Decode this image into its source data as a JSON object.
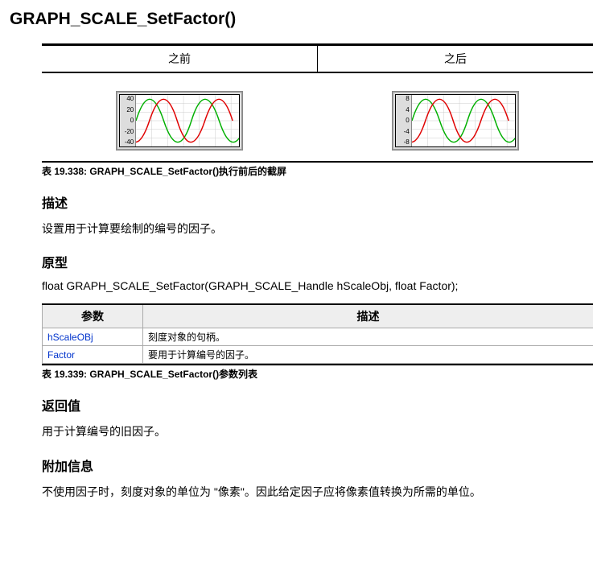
{
  "title": "GRAPH_SCALE_SetFactor()",
  "before_after": {
    "before_label": "之前",
    "after_label": "之后",
    "caption": "表 19.338: GRAPH_SCALE_SetFactor()执行前后的截屏"
  },
  "chart_data": [
    {
      "type": "line",
      "title": "Before",
      "y_ticks": [
        "40",
        "20",
        "0",
        "-20",
        "-40"
      ],
      "ylim": [
        -50,
        50
      ],
      "series": [
        {
          "name": "green",
          "color": "#00b000"
        },
        {
          "name": "red",
          "color": "#e00000"
        }
      ]
    },
    {
      "type": "line",
      "title": "After",
      "y_ticks": [
        "8",
        "4",
        "0",
        "-4",
        "-8"
      ],
      "ylim": [
        -10,
        10
      ],
      "series": [
        {
          "name": "green",
          "color": "#00b000"
        },
        {
          "name": "red",
          "color": "#e00000"
        }
      ]
    }
  ],
  "desc": {
    "heading": "描述",
    "text": "设置用于计算要绘制的编号的因子。"
  },
  "proto": {
    "heading": "原型",
    "text": "float GRAPH_SCALE_SetFactor(GRAPH_SCALE_Handle hScaleObj, float Factor);"
  },
  "params": {
    "col_param": "参数",
    "col_desc": "描述",
    "rows": [
      {
        "name": "hScaleOBj",
        "desc": "刻度对象的句柄。"
      },
      {
        "name": "Factor",
        "desc": "要用于计算编号的因子。"
      }
    ],
    "caption": "表 19.339: GRAPH_SCALE_SetFactor()参数列表"
  },
  "retval": {
    "heading": "返回值",
    "text": "用于计算编号的旧因子。"
  },
  "addinfo": {
    "heading": "附加信息",
    "text": "不使用因子时，刻度对象的单位为 \"像素\"。因此给定因子应将像素值转换为所需的单位。"
  }
}
